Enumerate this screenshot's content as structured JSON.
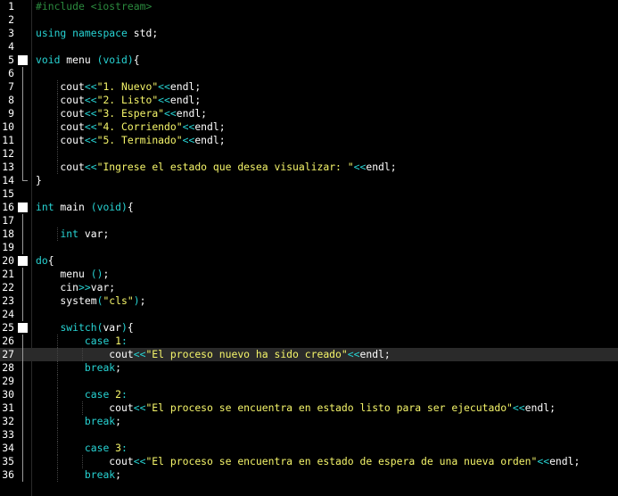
{
  "editor": {
    "current_line": 27,
    "lines": [
      {
        "n": "1",
        "fold": "none",
        "indent": 0,
        "tokens": [
          {
            "c": "pre",
            "t": "#include <iostream>"
          }
        ]
      },
      {
        "n": "2",
        "fold": "none",
        "indent": 0,
        "tokens": []
      },
      {
        "n": "3",
        "fold": "none",
        "indent": 0,
        "tokens": [
          {
            "c": "kw",
            "t": "using"
          },
          {
            "c": "id",
            "t": " "
          },
          {
            "c": "kw",
            "t": "namespace"
          },
          {
            "c": "id",
            "t": " std;"
          }
        ]
      },
      {
        "n": "4",
        "fold": "none",
        "indent": 0,
        "tokens": []
      },
      {
        "n": "5",
        "fold": "box",
        "indent": 0,
        "tokens": [
          {
            "c": "type",
            "t": "void"
          },
          {
            "c": "id",
            "t": " menu "
          },
          {
            "c": "op",
            "t": "(void)"
          },
          {
            "c": "punc",
            "t": "{"
          }
        ]
      },
      {
        "n": "6",
        "fold": "line",
        "indent": 0,
        "tokens": []
      },
      {
        "n": "7",
        "fold": "line",
        "indent": 1,
        "tokens": [
          {
            "c": "id",
            "t": "    cout"
          },
          {
            "c": "op",
            "t": "<<"
          },
          {
            "c": "str",
            "t": "\"1. Nuevo\""
          },
          {
            "c": "op",
            "t": "<<"
          },
          {
            "c": "id",
            "t": "endl;"
          }
        ]
      },
      {
        "n": "8",
        "fold": "line",
        "indent": 1,
        "tokens": [
          {
            "c": "id",
            "t": "    cout"
          },
          {
            "c": "op",
            "t": "<<"
          },
          {
            "c": "str",
            "t": "\"2. Listo\""
          },
          {
            "c": "op",
            "t": "<<"
          },
          {
            "c": "id",
            "t": "endl;"
          }
        ]
      },
      {
        "n": "9",
        "fold": "line",
        "indent": 1,
        "tokens": [
          {
            "c": "id",
            "t": "    cout"
          },
          {
            "c": "op",
            "t": "<<"
          },
          {
            "c": "str",
            "t": "\"3. Espera\""
          },
          {
            "c": "op",
            "t": "<<"
          },
          {
            "c": "id",
            "t": "endl;"
          }
        ]
      },
      {
        "n": "10",
        "fold": "line",
        "indent": 1,
        "tokens": [
          {
            "c": "id",
            "t": "    cout"
          },
          {
            "c": "op",
            "t": "<<"
          },
          {
            "c": "str",
            "t": "\"4. Corriendo\""
          },
          {
            "c": "op",
            "t": "<<"
          },
          {
            "c": "id",
            "t": "endl;"
          }
        ]
      },
      {
        "n": "11",
        "fold": "line",
        "indent": 1,
        "tokens": [
          {
            "c": "id",
            "t": "    cout"
          },
          {
            "c": "op",
            "t": "<<"
          },
          {
            "c": "str",
            "t": "\"5. Terminado\""
          },
          {
            "c": "op",
            "t": "<<"
          },
          {
            "c": "id",
            "t": "endl;"
          }
        ]
      },
      {
        "n": "12",
        "fold": "line",
        "indent": 1,
        "tokens": []
      },
      {
        "n": "13",
        "fold": "line",
        "indent": 1,
        "tokens": [
          {
            "c": "id",
            "t": "    cout"
          },
          {
            "c": "op",
            "t": "<<"
          },
          {
            "c": "str",
            "t": "\"Ingrese el estado que desea visualizar: \""
          },
          {
            "c": "op",
            "t": "<<"
          },
          {
            "c": "id",
            "t": "endl;"
          }
        ]
      },
      {
        "n": "14",
        "fold": "end",
        "indent": 0,
        "tokens": [
          {
            "c": "punc",
            "t": "}"
          }
        ]
      },
      {
        "n": "15",
        "fold": "none",
        "indent": 0,
        "tokens": []
      },
      {
        "n": "16",
        "fold": "box",
        "indent": 0,
        "tokens": [
          {
            "c": "type",
            "t": "int"
          },
          {
            "c": "id",
            "t": " main "
          },
          {
            "c": "op",
            "t": "(void)"
          },
          {
            "c": "punc",
            "t": "{"
          }
        ]
      },
      {
        "n": "17",
        "fold": "line",
        "indent": 0,
        "tokens": []
      },
      {
        "n": "18",
        "fold": "line",
        "indent": 1,
        "tokens": [
          {
            "c": "id",
            "t": "    "
          },
          {
            "c": "type",
            "t": "int"
          },
          {
            "c": "id",
            "t": " var;"
          }
        ]
      },
      {
        "n": "19",
        "fold": "line",
        "indent": 0,
        "tokens": []
      },
      {
        "n": "20",
        "fold": "box",
        "indent": 0,
        "tokens": [
          {
            "c": "kw",
            "t": "do"
          },
          {
            "c": "punc",
            "t": "{"
          }
        ]
      },
      {
        "n": "21",
        "fold": "line",
        "indent": 0,
        "tokens": [
          {
            "c": "id",
            "t": "    menu "
          },
          {
            "c": "op",
            "t": "()"
          },
          {
            "c": "id",
            "t": ";"
          }
        ]
      },
      {
        "n": "22",
        "fold": "line",
        "indent": 0,
        "tokens": [
          {
            "c": "id",
            "t": "    cin"
          },
          {
            "c": "op",
            "t": ">>"
          },
          {
            "c": "id",
            "t": "var;"
          }
        ]
      },
      {
        "n": "23",
        "fold": "line",
        "indent": 0,
        "tokens": [
          {
            "c": "id",
            "t": "    system"
          },
          {
            "c": "op",
            "t": "("
          },
          {
            "c": "str",
            "t": "\"cls\""
          },
          {
            "c": "op",
            "t": ")"
          },
          {
            "c": "id",
            "t": ";"
          }
        ]
      },
      {
        "n": "24",
        "fold": "line",
        "indent": 0,
        "tokens": []
      },
      {
        "n": "25",
        "fold": "box",
        "indent": 0,
        "tokens": [
          {
            "c": "id",
            "t": "    "
          },
          {
            "c": "kw",
            "t": "switch"
          },
          {
            "c": "op",
            "t": "("
          },
          {
            "c": "id",
            "t": "var"
          },
          {
            "c": "op",
            "t": ")"
          },
          {
            "c": "punc",
            "t": "{"
          }
        ]
      },
      {
        "n": "26",
        "fold": "line",
        "indent": 1,
        "tokens": [
          {
            "c": "id",
            "t": "        "
          },
          {
            "c": "kw",
            "t": "case"
          },
          {
            "c": "id",
            "t": " "
          },
          {
            "c": "num",
            "t": "1"
          },
          {
            "c": "op",
            "t": ":"
          }
        ]
      },
      {
        "n": "27",
        "fold": "line",
        "indent": 2,
        "tokens": [
          {
            "c": "id",
            "t": "            cout"
          },
          {
            "c": "op",
            "t": "<<"
          },
          {
            "c": "str",
            "t": "\"El proceso nuevo ha sido creado\""
          },
          {
            "c": "op",
            "t": "<<"
          },
          {
            "c": "id",
            "t": "endl;"
          }
        ]
      },
      {
        "n": "28",
        "fold": "line",
        "indent": 1,
        "tokens": [
          {
            "c": "id",
            "t": "        "
          },
          {
            "c": "kw",
            "t": "break"
          },
          {
            "c": "id",
            "t": ";"
          }
        ]
      },
      {
        "n": "29",
        "fold": "line",
        "indent": 1,
        "tokens": []
      },
      {
        "n": "30",
        "fold": "line",
        "indent": 1,
        "tokens": [
          {
            "c": "id",
            "t": "        "
          },
          {
            "c": "kw",
            "t": "case"
          },
          {
            "c": "id",
            "t": " "
          },
          {
            "c": "num",
            "t": "2"
          },
          {
            "c": "op",
            "t": ":"
          }
        ]
      },
      {
        "n": "31",
        "fold": "line",
        "indent": 2,
        "tokens": [
          {
            "c": "id",
            "t": "            cout"
          },
          {
            "c": "op",
            "t": "<<"
          },
          {
            "c": "str",
            "t": "\"El proceso se encuentra en estado listo para ser ejecutado\""
          },
          {
            "c": "op",
            "t": "<<"
          },
          {
            "c": "id",
            "t": "endl;"
          }
        ]
      },
      {
        "n": "32",
        "fold": "line",
        "indent": 1,
        "tokens": [
          {
            "c": "id",
            "t": "        "
          },
          {
            "c": "kw",
            "t": "break"
          },
          {
            "c": "id",
            "t": ";"
          }
        ]
      },
      {
        "n": "33",
        "fold": "line",
        "indent": 1,
        "tokens": []
      },
      {
        "n": "34",
        "fold": "line",
        "indent": 1,
        "tokens": [
          {
            "c": "id",
            "t": "        "
          },
          {
            "c": "kw",
            "t": "case"
          },
          {
            "c": "id",
            "t": " "
          },
          {
            "c": "num",
            "t": "3"
          },
          {
            "c": "op",
            "t": ":"
          }
        ]
      },
      {
        "n": "35",
        "fold": "line",
        "indent": 2,
        "tokens": [
          {
            "c": "id",
            "t": "            cout"
          },
          {
            "c": "op",
            "t": "<<"
          },
          {
            "c": "str",
            "t": "\"El proceso se encuentra en estado de espera de una nueva orden\""
          },
          {
            "c": "op",
            "t": "<<"
          },
          {
            "c": "id",
            "t": "endl;"
          }
        ]
      },
      {
        "n": "36",
        "fold": "line",
        "indent": 1,
        "tokens": [
          {
            "c": "id",
            "t": "        "
          },
          {
            "c": "kw",
            "t": "break"
          },
          {
            "c": "id",
            "t": ";"
          }
        ]
      }
    ]
  },
  "colors": {
    "background": "#000000",
    "preprocessor": "#2b8a3e",
    "keyword": "#27d3d3",
    "string": "#f5f56a",
    "text": "#ffffff",
    "current_line": "#2a2a2a"
  }
}
